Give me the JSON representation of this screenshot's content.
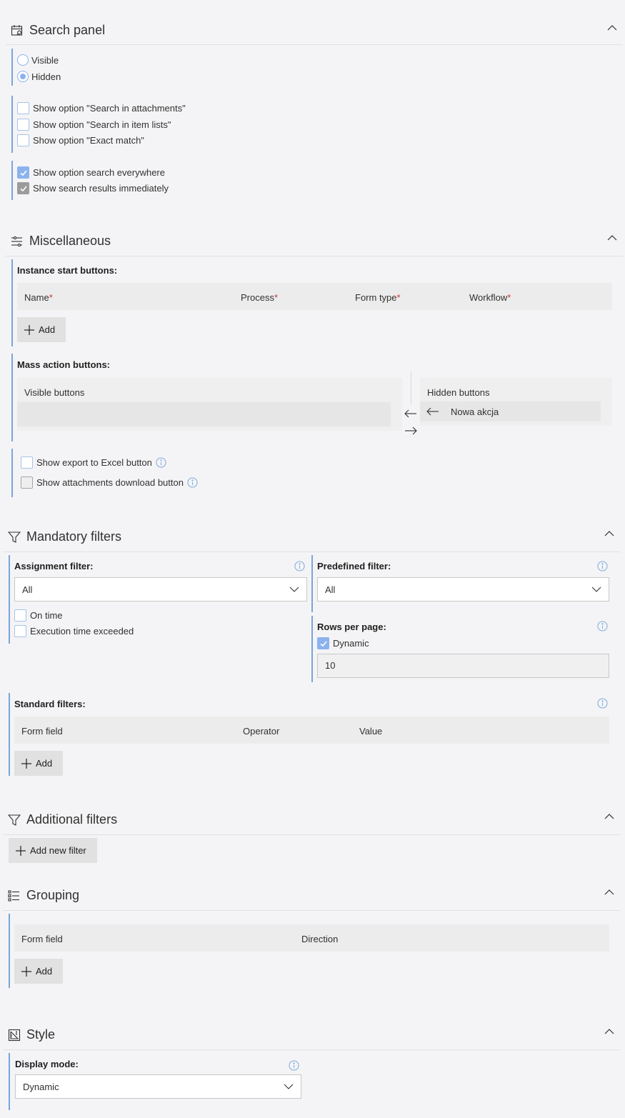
{
  "search_panel": {
    "title": "Search panel",
    "icon": "calendar-search-icon",
    "visibility": {
      "options": [
        "Visible",
        "Hidden"
      ],
      "selected": "Hidden"
    },
    "options_group1": [
      {
        "label": "Show option \"Search in attachments\"",
        "checked": false
      },
      {
        "label": "Show option \"Search in item lists\"",
        "checked": false
      },
      {
        "label": "Show option \"Exact match\"",
        "checked": false
      }
    ],
    "options_group2": [
      {
        "label": "Show option search everywhere",
        "checked": true
      },
      {
        "label": "Show search results immediately",
        "checked": true,
        "disabled": true
      }
    ]
  },
  "miscellaneous": {
    "title": "Miscellaneous",
    "icon": "sliders-icon",
    "instance_start": {
      "label": "Instance start buttons:",
      "columns": [
        {
          "label": "Name",
          "required": "*"
        },
        {
          "label": "Process",
          "required": "*"
        },
        {
          "label": "Form type",
          "required": "*"
        },
        {
          "label": "Workflow",
          "required": "*"
        }
      ],
      "add_label": "Add"
    },
    "mass_action": {
      "label": "Mass action buttons:",
      "visible_title": "Visible buttons",
      "visible_items": [],
      "hidden_title": "Hidden buttons",
      "hidden_items": [
        "Nowa akcja"
      ]
    },
    "options": [
      {
        "label": "Show export to Excel button",
        "checked": false
      },
      {
        "label": "Show attachments download button",
        "checked": false,
        "disabled": true
      }
    ]
  },
  "mandatory_filters": {
    "title": "Mandatory filters",
    "icon": "filter-icon",
    "assignment": {
      "label": "Assignment filter:",
      "value": "All",
      "checks": [
        {
          "label": "On time",
          "checked": false
        },
        {
          "label": "Execution time exceeded",
          "checked": false
        }
      ]
    },
    "predefined": {
      "label": "Predefined filter:",
      "value": "All"
    },
    "rows_per_page": {
      "label": "Rows per page:",
      "dynamic_label": "Dynamic",
      "dynamic_checked": true,
      "value": "10"
    },
    "standard": {
      "label": "Standard filters:",
      "columns": [
        "Form field",
        "Operator",
        "Value"
      ],
      "add_label": "Add"
    }
  },
  "additional_filters": {
    "title": "Additional filters",
    "icon": "filter-icon",
    "add_label": "Add new filter"
  },
  "grouping": {
    "title": "Grouping",
    "icon": "bulleted-list-icon",
    "columns": [
      "Form field",
      "Direction"
    ],
    "add_label": "Add"
  },
  "style": {
    "title": "Style",
    "icon": "ruler-triangle-icon",
    "display_mode": {
      "label": "Display mode:",
      "value": "Dynamic"
    }
  },
  "colors": {
    "accent": "#7aa6d8",
    "check_fill": "#8cb2ee",
    "required": "#d13438"
  }
}
